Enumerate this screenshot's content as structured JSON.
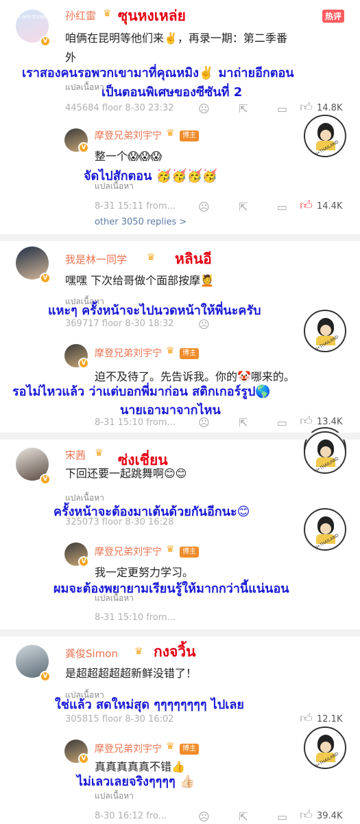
{
  "comments": [
    {
      "name": "孙红雷",
      "thai_name": "ซุนหงเหล่ย",
      "hot_label": "热评",
      "avatar_text": "I am three",
      "text_lines": [
        "咱俩在昆明等他们来✌️，再录一期：第二季番",
        "外"
      ],
      "thai_lines": [
        "เราสองคนรอพวกเขามาที่คุณหมิง✌️ มาถ่ายอีกตอน",
        "เป็นตอนพิเศษของซีซันที่ 2"
      ],
      "translate": "แปลเนื้อหา",
      "meta": "445684 floor  8-30 23:32",
      "likes": "14.8K",
      "reply": {
        "name": "摩登兄弟刘宇宁",
        "tag": "博主",
        "text": "整一个😱😱😱",
        "thai": "จัดไปสักตอน 🥳🥳🥳🥳",
        "translate": "แปลเนื้อหา",
        "meta": "8-31 15:11  from...",
        "likes": "14.4K"
      },
      "more_replies": "other 3050 replies >"
    },
    {
      "name": "我是林一同学",
      "thai_name": "หลินอี",
      "text_lines": [
        "嘿嘿 下次给哥做个面部按摩💆"
      ],
      "thai_lines": [
        "แหะๆ ครั้งหน้าจะไปนวดหน้าให้พี่นะครับ"
      ],
      "translate": "แปลเนื้อหา",
      "meta": "369717 floor  8-30 18:32",
      "likes": "",
      "reply": {
        "name": "摩登兄弟刘宇宁",
        "tag": "博主",
        "text": "迫不及待了。先告诉我。你的🤡哪来的。",
        "thai_lines": [
          "รอไม่ไหวแล้ว ว่าแต่บอกพี่มาก่อน  สติกเกอร์รูป🌎",
          "นายเอามาจากไหน"
        ],
        "meta": "8-31 15:10  from...",
        "likes": "13.4K"
      }
    },
    {
      "name": "宋茜",
      "thai_name": "ซ่งเชี่ยน",
      "text_lines": [
        "下回还要一起跳舞啊😊😊"
      ],
      "thai_lines": [
        "ครั้งหน้าจะต้องมาเต้นด้วยกันอีกนะ😊"
      ],
      "translate": "แปลเนื้อหา",
      "meta": "325073 floor  8-30 16:28",
      "likes": "",
      "reply": {
        "name": "摩登兄弟刘宇宁",
        "tag": "博主",
        "text": "我一定更努力学习。",
        "thai": "ผมจะต้องพยายามเรียนรู้ให้มากกว่านี้แน่นอน",
        "translate": "แปลเนื้อหา",
        "meta": "8-31 15:10  from...",
        "likes": ""
      }
    },
    {
      "name": "龚俊Simon",
      "thai_name": "กงจวิ้น",
      "text_lines": [
        "是超超超超超新鲜没错了！"
      ],
      "thai_lines": [
        "ใช่แล้ว สดใหม่สุด ๆๆๆๆๆๆๆๆ ไปเลย"
      ],
      "translate": "แปลเนื้อหา",
      "meta": "305815 floor  8-30 16:02",
      "likes": "12.1K",
      "reply": {
        "name": "摩登兄弟刘宇宁",
        "tag": "博主",
        "text": "真真真真真不错👍",
        "thai": "ไม่เลวเลยจริงๆๆๆๆ 👍🏻",
        "translate": "แปลเนื้อหา",
        "meta": "8-30 16:12  fro...",
        "likes": "39.4K"
      }
    }
  ],
  "watermark_text": "LYN•THAILAND",
  "colors": {
    "thai_name": "#e60012",
    "thai_translation": "#1a1ad6",
    "username": "#eb7350",
    "like_red": "#ff4a4a"
  }
}
